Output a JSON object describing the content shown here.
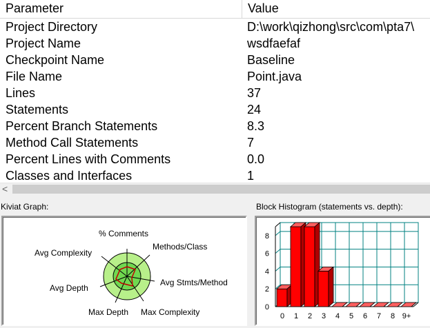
{
  "table": {
    "header": {
      "param": "Parameter",
      "value": "Value"
    },
    "rows": [
      {
        "param": "Project Directory",
        "value": "D:\\work\\qizhong\\src\\com\\pta7\\"
      },
      {
        "param": "Project Name",
        "value": "wsdfaefaf"
      },
      {
        "param": "Checkpoint Name",
        "value": "Baseline"
      },
      {
        "param": "File Name",
        "value": "Point.java"
      },
      {
        "param": "Lines",
        "value": "37"
      },
      {
        "param": "Statements",
        "value": "24"
      },
      {
        "param": "Percent Branch Statements",
        "value": "8.3"
      },
      {
        "param": "Method Call Statements",
        "value": "7"
      },
      {
        "param": "Percent Lines with Comments",
        "value": "0.0"
      },
      {
        "param": "Classes and Interfaces",
        "value": "1"
      }
    ]
  },
  "scrollbar": {
    "left_arrow": "<"
  },
  "kiviat": {
    "title": "Kiviat Graph:",
    "axes": {
      "comments": "% Comments",
      "methods_class": "Methods/Class",
      "avg_stmts": "Avg Stmts/Method",
      "max_complexity": "Max Complexity",
      "max_depth": "Max Depth",
      "avg_depth": "Avg Depth",
      "avg_complexity": "Avg Complexity"
    },
    "colors": {
      "outer_ring": "#b8f08a",
      "inner_ring": "#70d850",
      "plot_line": "#c00000"
    }
  },
  "histogram": {
    "title": "Block Histogram (statements vs. depth):",
    "bar_color": "#ff0000",
    "grid_color": "#008080",
    "chart_data": {
      "type": "bar",
      "categories": [
        "0",
        "1",
        "2",
        "3",
        "4",
        "5",
        "6",
        "7",
        "8",
        "9+"
      ],
      "values": [
        2,
        9,
        9,
        4,
        0,
        0,
        0,
        0,
        0,
        0
      ],
      "yticks": [
        "0",
        "2",
        "4",
        "6",
        "8"
      ],
      "ylim": [
        0,
        9
      ]
    }
  }
}
